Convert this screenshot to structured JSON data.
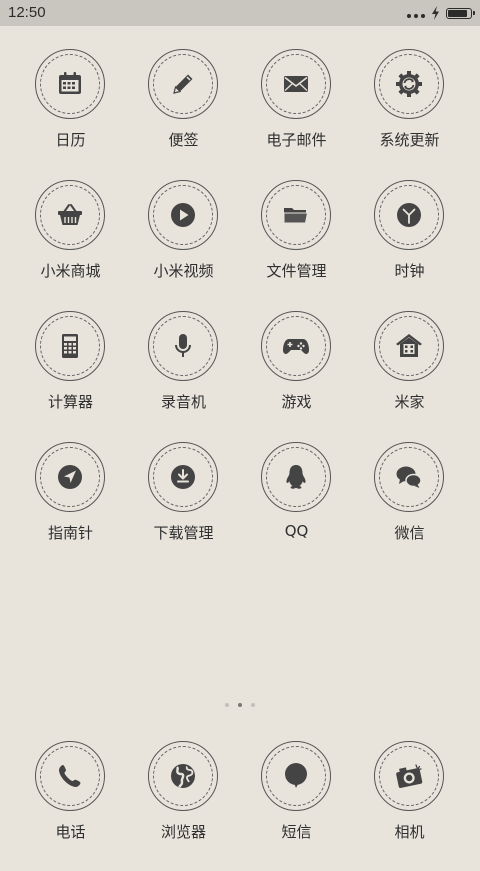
{
  "status_bar": {
    "time": "12:50",
    "battery_level": 0.85
  },
  "apps": [
    {
      "label": "日历",
      "icon": "calendar-icon"
    },
    {
      "label": "便签",
      "icon": "pencil-icon"
    },
    {
      "label": "电子邮件",
      "icon": "envelope-icon"
    },
    {
      "label": "系统更新",
      "icon": "refresh-gear-icon"
    },
    {
      "label": "小米商城",
      "icon": "basket-icon"
    },
    {
      "label": "小米视频",
      "icon": "play-icon"
    },
    {
      "label": "文件管理",
      "icon": "folder-icon"
    },
    {
      "label": "时钟",
      "icon": "clock-icon"
    },
    {
      "label": "计算器",
      "icon": "calculator-icon"
    },
    {
      "label": "录音机",
      "icon": "microphone-icon"
    },
    {
      "label": "游戏",
      "icon": "gamepad-icon"
    },
    {
      "label": "米家",
      "icon": "home-icon"
    },
    {
      "label": "指南针",
      "icon": "compass-icon"
    },
    {
      "label": "下载管理",
      "icon": "download-icon"
    },
    {
      "label": "QQ",
      "icon": "penguin-icon"
    },
    {
      "label": "微信",
      "icon": "chat-bubbles-icon"
    }
  ],
  "page_indicator": {
    "pages": 3,
    "current": 2
  },
  "dock": [
    {
      "label": "电话",
      "icon": "phone-icon"
    },
    {
      "label": "浏览器",
      "icon": "globe-icon"
    },
    {
      "label": "短信",
      "icon": "message-bubble-icon"
    },
    {
      "label": "相机",
      "icon": "camera-icon"
    }
  ]
}
